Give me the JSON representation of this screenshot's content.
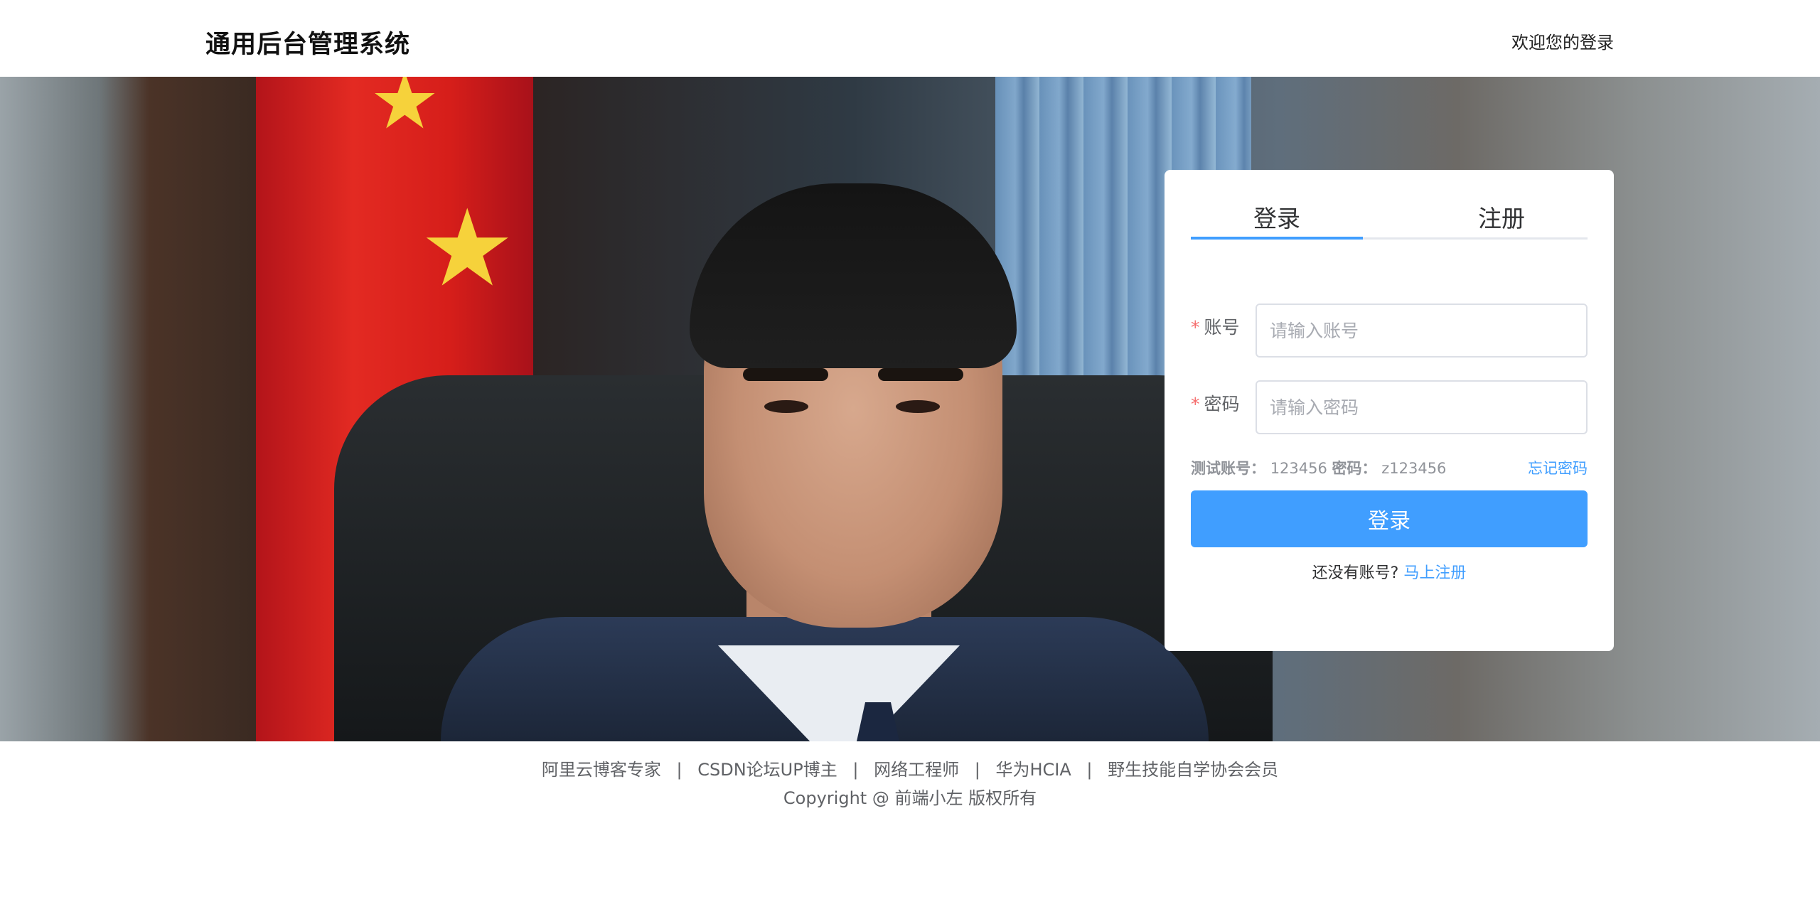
{
  "header": {
    "title": "通用后台管理系统",
    "welcome": "欢迎您的登录"
  },
  "login_card": {
    "tabs": [
      {
        "label": "登录",
        "active": true
      },
      {
        "label": "注册",
        "active": false
      }
    ],
    "account": {
      "label": "账号",
      "placeholder": "请输入账号",
      "value": ""
    },
    "password": {
      "label": "密码",
      "placeholder": "请输入密码",
      "value": ""
    },
    "hint": {
      "account_label": "测试账号：",
      "account_value": "123456",
      "password_label": "密码：",
      "password_value": "z123456"
    },
    "forgot_label": "忘记密码",
    "submit_label": "登录",
    "no_account_text": "还没有账号?",
    "register_now_label": "马上注册"
  },
  "footer": {
    "links": [
      "阿里云博客专家",
      "CSDN论坛UP博主",
      "网络工程师",
      "华为HCIA",
      "野生技能自学协会会员"
    ],
    "separator": "|",
    "copyright": "Copyright @ 前端小左 版权所有"
  },
  "colors": {
    "accent": "#409eff",
    "required": "#f56c6c"
  }
}
